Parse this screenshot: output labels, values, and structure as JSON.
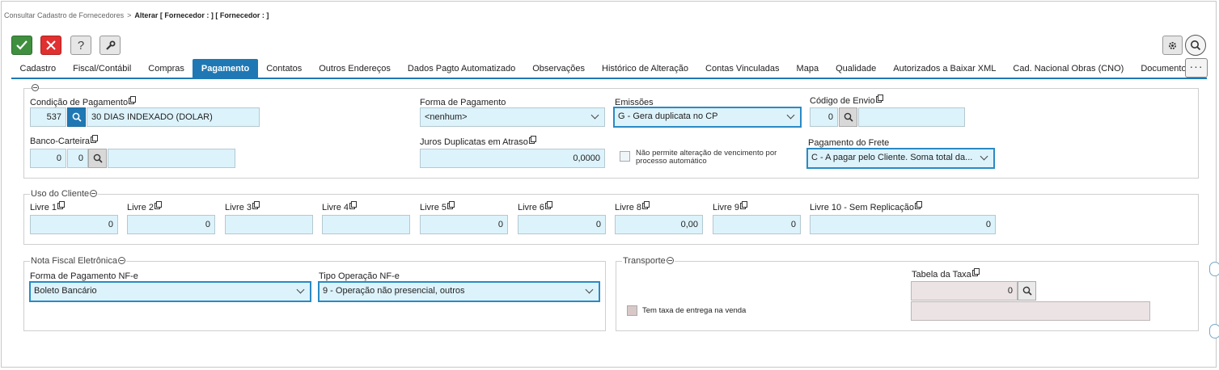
{
  "breadcrumb": {
    "parent": "Consultar Cadastro de Fornecedores",
    "separator": ">",
    "current": "Alterar [ Fornecedor : ] [ Fornecedor : ]"
  },
  "toolbar": {
    "help_label": "?"
  },
  "tabs": [
    "Cadastro",
    "Fiscal/Contábil",
    "Compras",
    "Pagamento",
    "Contatos",
    "Outros Endereços",
    "Dados Pagto Automatizado",
    "Observações",
    "Histórico de Alteração",
    "Contas Vinculadas",
    "Mapa",
    "Qualidade",
    "Autorizados a Baixar XML",
    "Cad. Nacional Obras (CNO)",
    "Documentos Anexos"
  ],
  "active_tab": "Pagamento",
  "tab_more_label": "···",
  "pagamento": {
    "condicao": {
      "label": "Condição de Pagamento",
      "code": "537",
      "description": "30 DIAS INDEXADO (DOLAR)"
    },
    "forma": {
      "label": "Forma de Pagamento",
      "value": "<nenhum>"
    },
    "emissoes": {
      "label": "Emissões",
      "value": "G - Gera duplicata no CP"
    },
    "codigo_envio": {
      "label": "Código de Envio",
      "value": "0"
    },
    "banco_carteira": {
      "label": "Banco-Carteira",
      "banco": "0",
      "carteira": "0"
    },
    "juros": {
      "label": "Juros Duplicatas em Atraso",
      "value": "0,0000"
    },
    "nao_permite": {
      "label_line1": "Não permite alteração de vencimento por",
      "label_line2": "processo automático"
    },
    "frete": {
      "label": "Pagamento do Frete",
      "value": "C - A pagar pelo Cliente. Soma total da..."
    }
  },
  "uso_cliente": {
    "title": "Uso do Cliente",
    "fields": [
      {
        "label": "Livre 1",
        "value": "0"
      },
      {
        "label": "Livre 2",
        "value": "0"
      },
      {
        "label": "Livre 3",
        "value": ""
      },
      {
        "label": "Livre 4",
        "value": ""
      },
      {
        "label": "Livre 5",
        "value": "0"
      },
      {
        "label": "Livre 6",
        "value": "0"
      },
      {
        "label": "Livre 8",
        "value": "0,00"
      },
      {
        "label": "Livre 9",
        "value": "0"
      },
      {
        "label": "Livre 10 - Sem Replicação",
        "value": "0"
      }
    ]
  },
  "nfe": {
    "title": "Nota Fiscal Eletrônica",
    "forma": {
      "label": "Forma de Pagamento NF-e",
      "value": "Boleto Bancário"
    },
    "tipo": {
      "label": "Tipo Operação NF-e",
      "value": "9 - Operação não presencial, outros"
    }
  },
  "transporte": {
    "title": "Transporte",
    "tabela": {
      "label": "Tabela da Taxa",
      "value": "0",
      "description": ""
    },
    "taxa_entrega": {
      "label": "Tem taxa de entrega na venda"
    }
  },
  "colors": {
    "accent": "#1f78b4",
    "input_bg": "#ddf3fb",
    "ok": "#3f8f3f",
    "cancel": "#e03030"
  }
}
